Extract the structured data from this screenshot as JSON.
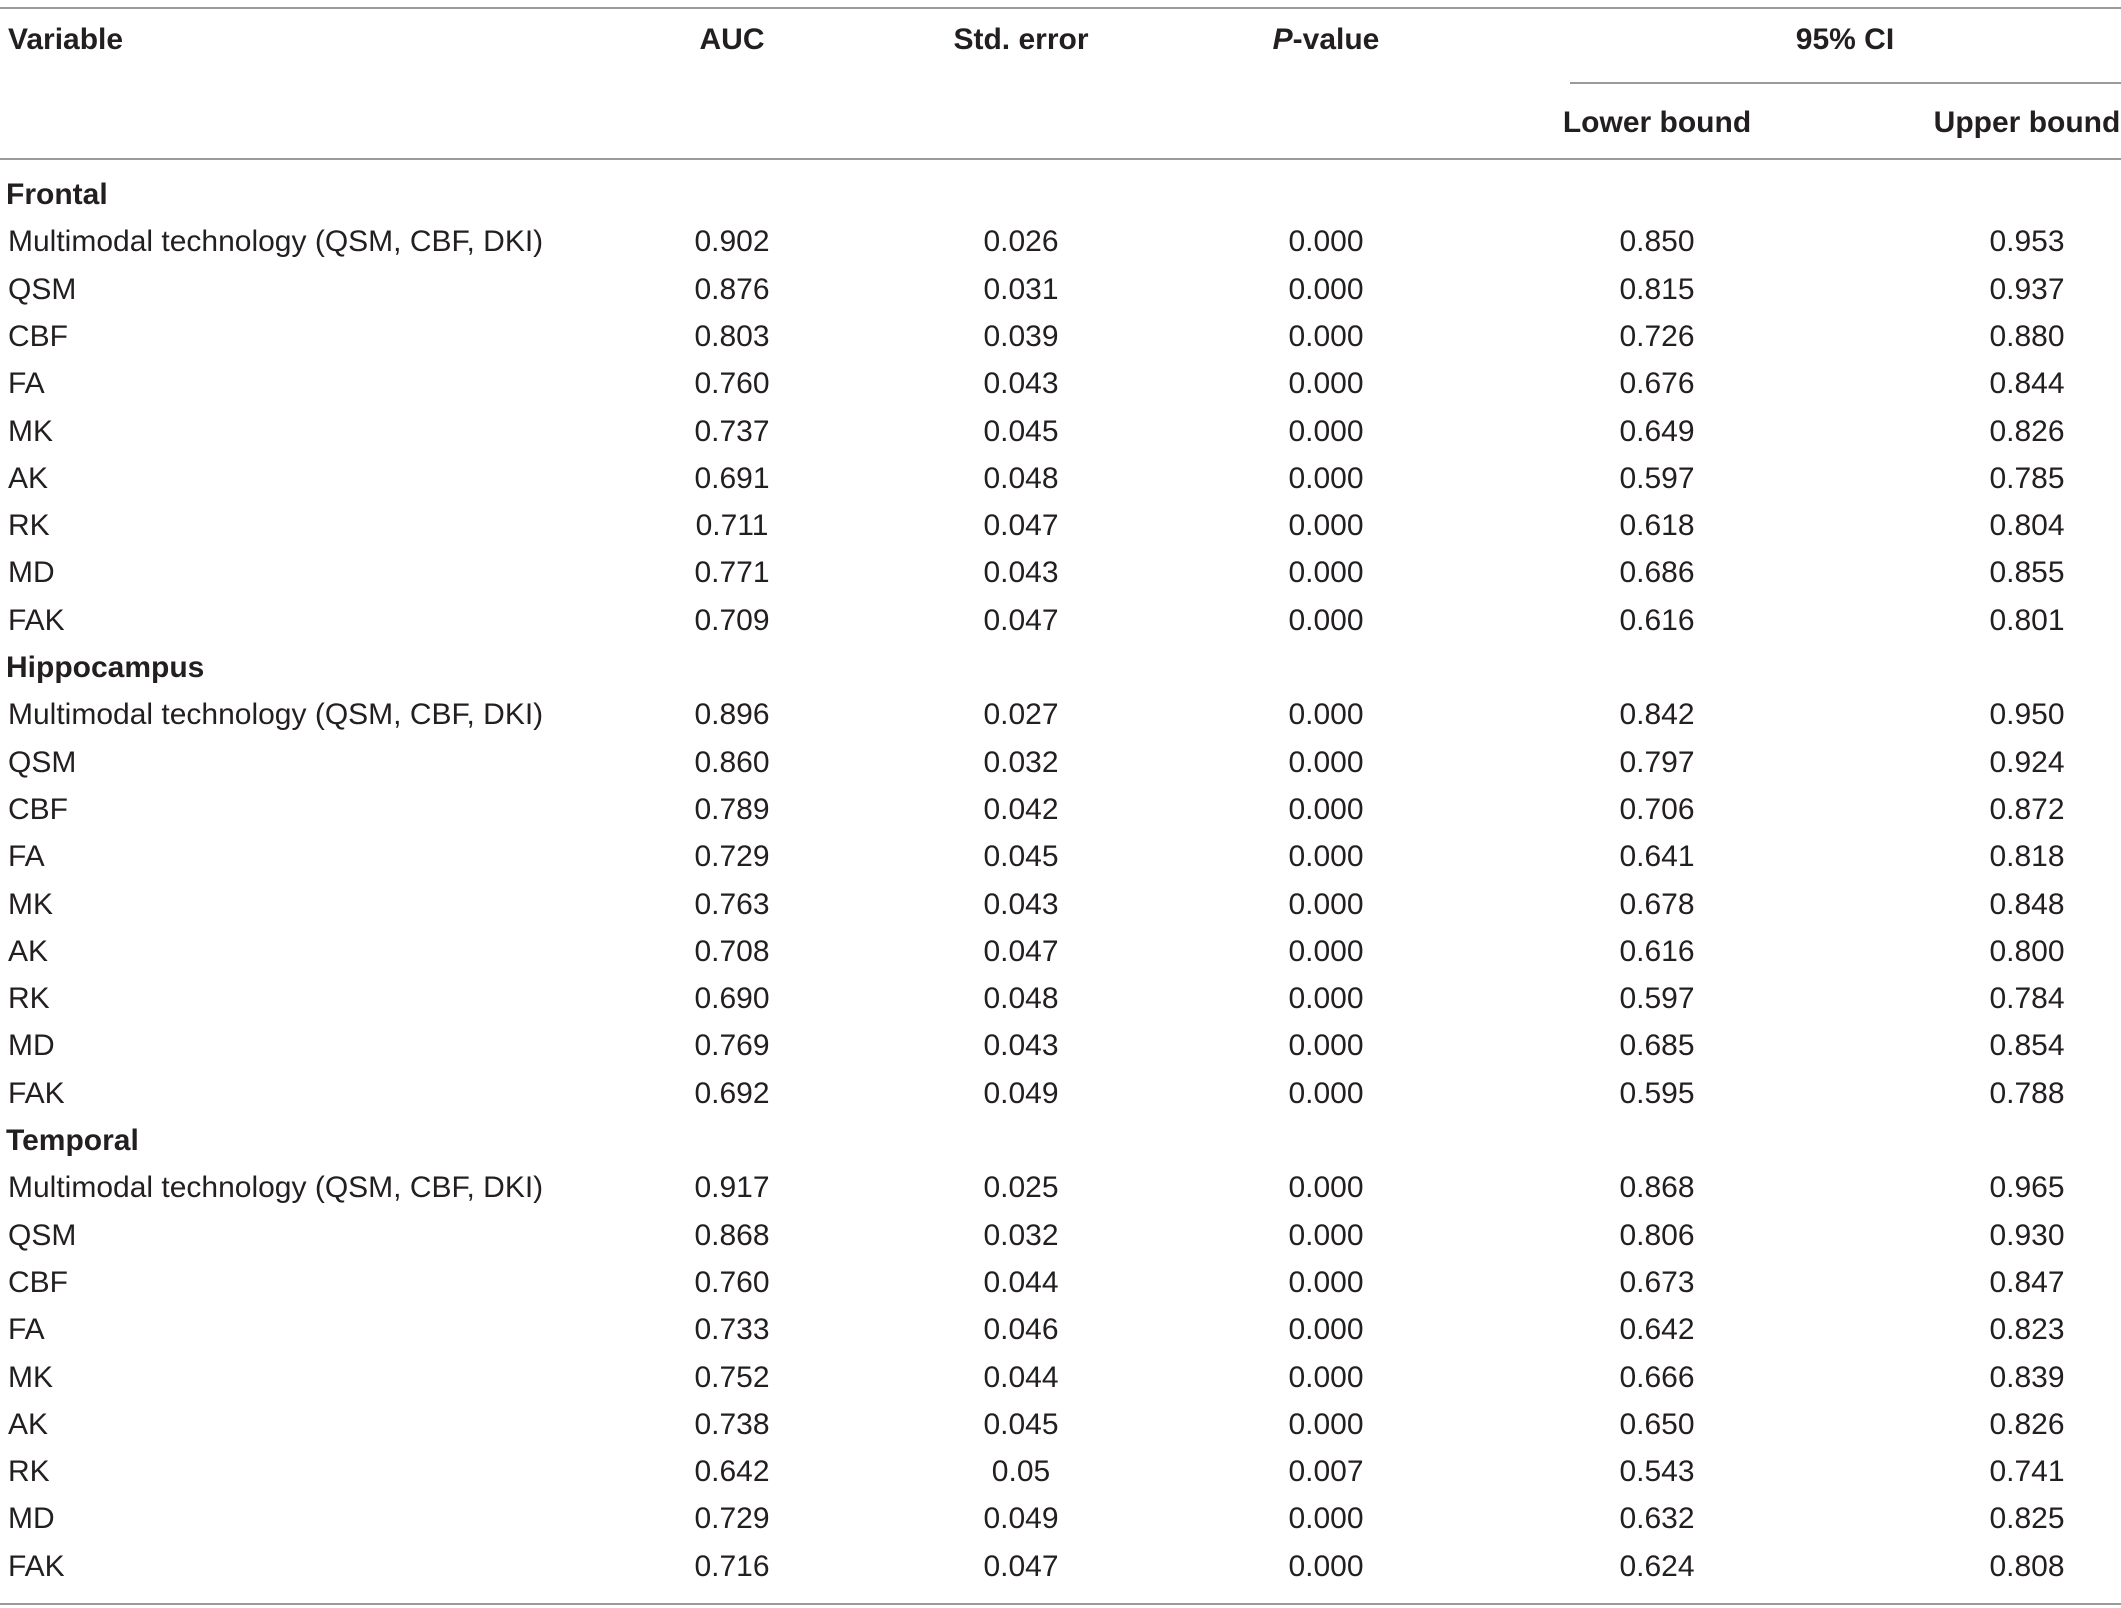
{
  "headers": {
    "variable": "Variable",
    "auc": "AUC",
    "std_error": "Std. error",
    "p_value_italic": "P",
    "p_value_rest": "-value",
    "ci": "95% CI",
    "lower_bound": "Lower bound",
    "upper_bound": "Upper bound"
  },
  "sections": [
    {
      "title": "Frontal",
      "rows": [
        {
          "variable": "Multimodal technology (QSM, CBF, DKI)",
          "auc": "0.902",
          "se": "0.026",
          "p": "0.000",
          "lb": "0.850",
          "ub": "0.953"
        },
        {
          "variable": "QSM",
          "auc": "0.876",
          "se": "0.031",
          "p": "0.000",
          "lb": "0.815",
          "ub": "0.937"
        },
        {
          "variable": "CBF",
          "auc": "0.803",
          "se": "0.039",
          "p": "0.000",
          "lb": "0.726",
          "ub": "0.880"
        },
        {
          "variable": "FA",
          "auc": "0.760",
          "se": "0.043",
          "p": "0.000",
          "lb": "0.676",
          "ub": "0.844"
        },
        {
          "variable": "MK",
          "auc": "0.737",
          "se": "0.045",
          "p": "0.000",
          "lb": "0.649",
          "ub": "0.826"
        },
        {
          "variable": "AK",
          "auc": "0.691",
          "se": "0.048",
          "p": "0.000",
          "lb": "0.597",
          "ub": "0.785"
        },
        {
          "variable": "RK",
          "auc": "0.711",
          "se": "0.047",
          "p": "0.000",
          "lb": "0.618",
          "ub": "0.804"
        },
        {
          "variable": "MD",
          "auc": "0.771",
          "se": "0.043",
          "p": "0.000",
          "lb": "0.686",
          "ub": "0.855"
        },
        {
          "variable": "FAK",
          "auc": "0.709",
          "se": "0.047",
          "p": "0.000",
          "lb": "0.616",
          "ub": "0.801"
        }
      ]
    },
    {
      "title": "Hippocampus",
      "rows": [
        {
          "variable": "Multimodal technology (QSM, CBF, DKI)",
          "auc": "0.896",
          "se": "0.027",
          "p": "0.000",
          "lb": "0.842",
          "ub": "0.950"
        },
        {
          "variable": "QSM",
          "auc": "0.860",
          "se": "0.032",
          "p": "0.000",
          "lb": "0.797",
          "ub": "0.924"
        },
        {
          "variable": "CBF",
          "auc": "0.789",
          "se": "0.042",
          "p": "0.000",
          "lb": "0.706",
          "ub": "0.872"
        },
        {
          "variable": "FA",
          "auc": "0.729",
          "se": "0.045",
          "p": "0.000",
          "lb": "0.641",
          "ub": "0.818"
        },
        {
          "variable": "MK",
          "auc": "0.763",
          "se": "0.043",
          "p": "0.000",
          "lb": "0.678",
          "ub": "0.848"
        },
        {
          "variable": "AK",
          "auc": "0.708",
          "se": "0.047",
          "p": "0.000",
          "lb": "0.616",
          "ub": "0.800"
        },
        {
          "variable": "RK",
          "auc": "0.690",
          "se": "0.048",
          "p": "0.000",
          "lb": "0.597",
          "ub": "0.784"
        },
        {
          "variable": "MD",
          "auc": "0.769",
          "se": "0.043",
          "p": "0.000",
          "lb": "0.685",
          "ub": "0.854"
        },
        {
          "variable": "FAK",
          "auc": "0.692",
          "se": "0.049",
          "p": "0.000",
          "lb": "0.595",
          "ub": "0.788"
        }
      ]
    },
    {
      "title": "Temporal",
      "rows": [
        {
          "variable": "Multimodal technology (QSM, CBF, DKI)",
          "auc": "0.917",
          "se": "0.025",
          "p": "0.000",
          "lb": "0.868",
          "ub": "0.965"
        },
        {
          "variable": "QSM",
          "auc": "0.868",
          "se": "0.032",
          "p": "0.000",
          "lb": "0.806",
          "ub": "0.930"
        },
        {
          "variable": "CBF",
          "auc": "0.760",
          "se": "0.044",
          "p": "0.000",
          "lb": "0.673",
          "ub": "0.847"
        },
        {
          "variable": "FA",
          "auc": "0.733",
          "se": "0.046",
          "p": "0.000",
          "lb": "0.642",
          "ub": "0.823"
        },
        {
          "variable": "MK",
          "auc": "0.752",
          "se": "0.044",
          "p": "0.000",
          "lb": "0.666",
          "ub": "0.839"
        },
        {
          "variable": "AK",
          "auc": "0.738",
          "se": "0.045",
          "p": "0.000",
          "lb": "0.650",
          "ub": "0.826"
        },
        {
          "variable": "RK",
          "auc": "0.642",
          "se": "0.05",
          "p": "0.007",
          "lb": "0.543",
          "ub": "0.741"
        },
        {
          "variable": "MD",
          "auc": "0.729",
          "se": "0.049",
          "p": "0.000",
          "lb": "0.632",
          "ub": "0.825"
        },
        {
          "variable": "FAK",
          "auc": "0.716",
          "se": "0.047",
          "p": "0.000",
          "lb": "0.624",
          "ub": "0.808"
        }
      ]
    }
  ]
}
